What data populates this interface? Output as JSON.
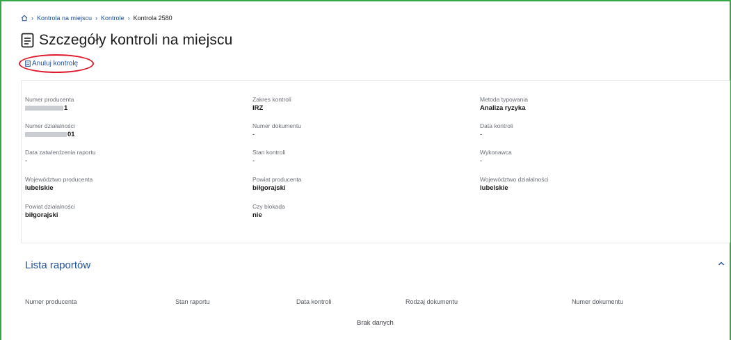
{
  "breadcrumb": {
    "items": [
      "Kontrola na miejscu",
      "Kontrole",
      "Kontrola 2580"
    ],
    "separator": "›"
  },
  "page": {
    "title": "Szczegóły kontroli na miejscu"
  },
  "actions": {
    "cancel_label": "Anuluj kontrolę"
  },
  "details": {
    "numer_producenta": {
      "label": "Numer producenta",
      "value_tail": "1"
    },
    "zakres_kontroli": {
      "label": "Zakres kontroli",
      "value": "IRZ"
    },
    "metoda_typowania": {
      "label": "Metoda typowania",
      "value": "Analiza ryzyka"
    },
    "numer_dzialalnosci": {
      "label": "Numer działalności",
      "value_tail": "01"
    },
    "numer_dokumentu": {
      "label": "Numer dokumentu",
      "value": "-"
    },
    "data_kontroli": {
      "label": "Data kontroli",
      "value": "-"
    },
    "data_zatwierdzenia": {
      "label": "Data zatwierdzenia raportu",
      "value": "-"
    },
    "stan_kontroli": {
      "label": "Stan kontroli",
      "value": "-"
    },
    "wykonawca": {
      "label": "Wykonawca",
      "value": "-"
    },
    "wojewodztwo_producenta": {
      "label": "Województwo producenta",
      "value": "lubelskie"
    },
    "powiat_producenta": {
      "label": "Powiat producenta",
      "value": "biłgorajski"
    },
    "wojewodztwo_dzialalnosci": {
      "label": "Województwo działalności",
      "value": "lubelskie"
    },
    "powiat_dzialalnosci": {
      "label": "Powiat działalności",
      "value": "biłgorajski"
    },
    "czy_blokada": {
      "label": "Czy blokada",
      "value": "nie"
    }
  },
  "reports": {
    "title": "Lista raportów",
    "columns": [
      "Numer producenta",
      "Stan raportu",
      "Data kontroli",
      "Rodzaj dokumentu",
      "Numer dokumentu"
    ],
    "empty_text": "Brak danych"
  },
  "colors": {
    "link": "#1f4f9a",
    "frame_border": "#35a84a",
    "highlight": "#e0182b"
  }
}
